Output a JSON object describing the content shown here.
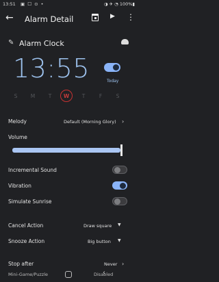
{
  "status_bar": {
    "time": "13:51",
    "icons_text": "▣ ☐ ⊙ •",
    "right_text": "◑ ✈ ◔ 100%▮"
  },
  "app_bar": {
    "title": "Alarm Detail"
  },
  "alarm": {
    "label": "Alarm Clock",
    "time": "13:55",
    "enabled": true,
    "today_label": "Today",
    "days": [
      "S",
      "M",
      "T",
      "W",
      "T",
      "F",
      "S"
    ],
    "selected_day_index": 3
  },
  "settings": {
    "melody_label": "Melody",
    "melody_value": "Default (Morning Glory)",
    "volume_label": "Volume",
    "volume_level": 0.99,
    "incremental_label": "Incremental Sound",
    "incremental_on": false,
    "vibration_label": "Vibration",
    "vibration_on": true,
    "sunrise_label": "Simulate Sunrise",
    "sunrise_on": false,
    "cancel_label": "Cancel Action",
    "cancel_value": "Draw square",
    "snooze_label": "Snooze Action",
    "snooze_value": "Big button",
    "stop_label": "Stop after",
    "stop_value": "Never"
  },
  "nav_bar": {
    "left_text": "Mini-Game/Puzzle",
    "right_text": "Disabled"
  },
  "icons": [
    "back-arrow-icon",
    "calendar-icon",
    "play-icon",
    "more-vert-icon",
    "pencil-icon",
    "cloud-icon",
    "chevron-right-icon",
    "dropdown-arrow-icon"
  ],
  "colors": {
    "background": "#202124",
    "accent": "#8ab4f8",
    "time_text": "#9dc2ee",
    "selected_day": "#c83232"
  }
}
